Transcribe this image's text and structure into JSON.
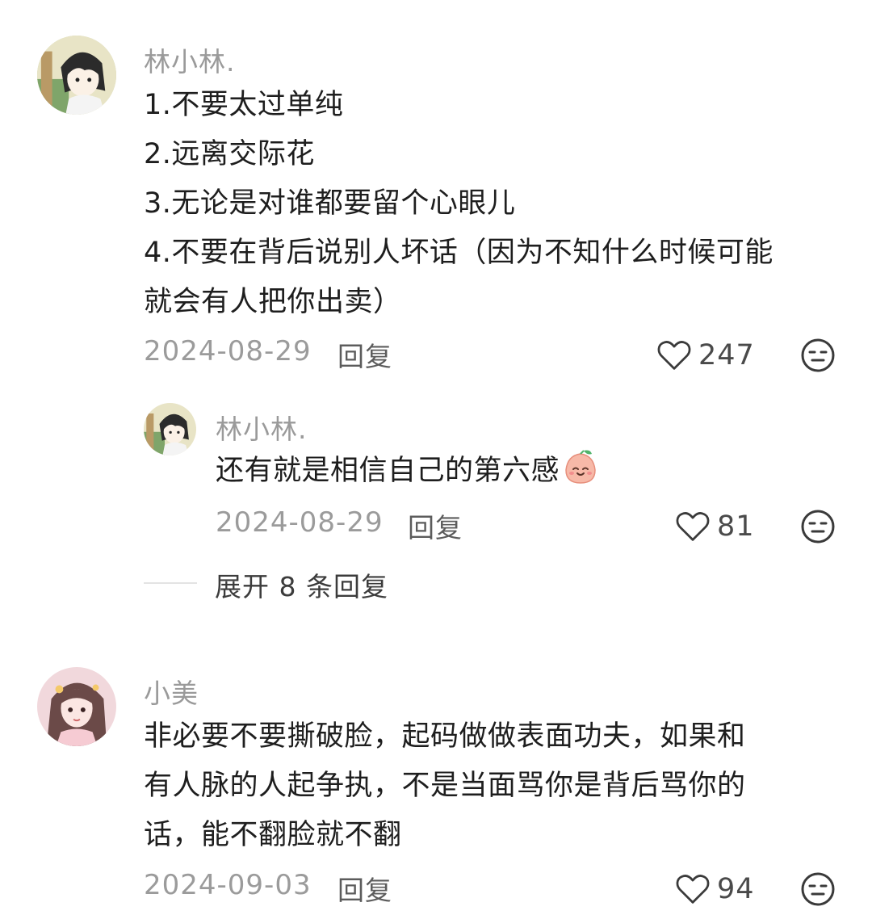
{
  "comments": [
    {
      "username": "林小林.",
      "lines": [
        "1.不要太过单纯",
        "2.远离交际花",
        "3.无论是对谁都要留个心眼儿",
        "4.不要在背后说别人坏话（因为不知什么时候可能",
        "就会有人把你出卖）"
      ],
      "date": "2024-08-29",
      "reply_label": "回复",
      "likes": "247",
      "avatar_icon": "avatar-anime-boy",
      "reply": {
        "username": "林小林.",
        "text": "还有就是相信自己的第六感",
        "emoji_icon": "peach-smile-emoji",
        "date": "2024-08-29",
        "reply_label": "回复",
        "likes": "81"
      },
      "expand_label": "展开 8 条回复"
    },
    {
      "username": "小美",
      "lines": [
        "非必要不要撕破脸，起码做做表面功夫，如果和",
        "有人脉的人起争执，不是当面骂你是背后骂你的",
        "话，能不翻脸就不翻"
      ],
      "date": "2024-09-03",
      "reply_label": "回复",
      "likes": "94",
      "avatar_icon": "avatar-anime-girl"
    }
  ],
  "icons": {
    "like": "heart-outline-icon",
    "dislike": "neutral-face-icon"
  },
  "colors": {
    "username": "#9a9a9a",
    "text": "#1e1e1e",
    "meta": "#9b9b9b"
  }
}
